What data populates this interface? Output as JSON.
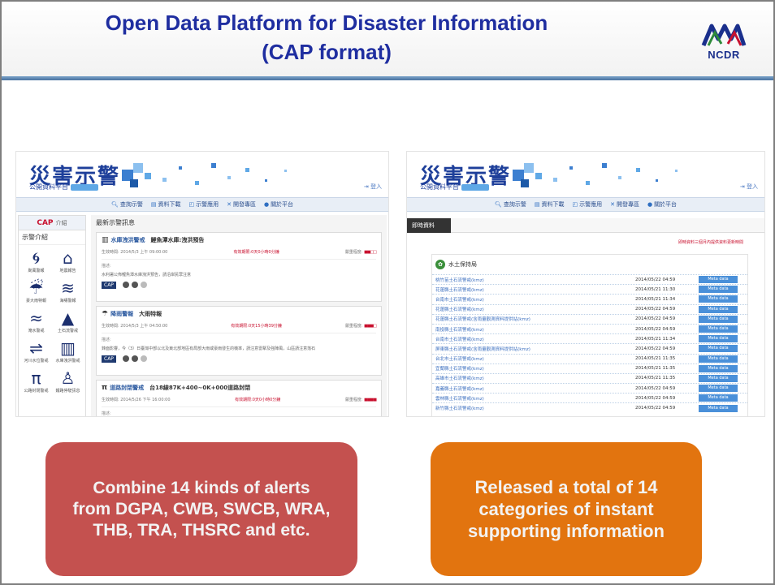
{
  "slide": {
    "title": "Open Data Platform for Disaster Information\n(CAP format)",
    "logo_text": "NCDR",
    "colors": {
      "title": "#1f2ea0",
      "red_bubble": "#c4514f",
      "orange_bubble": "#e2740f",
      "rule": "#4a72a0"
    }
  },
  "left_screenshot": {
    "brand": "災害示警",
    "brand_sub": "公開資料平台",
    "login": "登入",
    "nav": [
      {
        "icon": "search-icon",
        "label": "查詢示警"
      },
      {
        "icon": "download-icon",
        "label": "資料下載"
      },
      {
        "icon": "apps-icon",
        "label": "示警應用"
      },
      {
        "icon": "tools-icon",
        "label": "開發專區"
      },
      {
        "icon": "info-icon",
        "label": "關於平台"
      }
    ],
    "sidebar": {
      "cap_label": "CAP",
      "cap_suffix": "介紹",
      "section_title": "示警介紹",
      "icons": [
        {
          "icon": "typhoon-icon",
          "label": "颱風警報"
        },
        {
          "icon": "house-icon",
          "label": "地震報告"
        },
        {
          "icon": "rain-icon",
          "label": "豪大雨特報"
        },
        {
          "icon": "wave-icon",
          "label": "海嘯警報"
        },
        {
          "icon": "flood-icon",
          "label": "淹水警戒"
        },
        {
          "icon": "landslide-icon",
          "label": "土石流警戒"
        },
        {
          "icon": "river-icon",
          "label": "河川水位警戒"
        },
        {
          "icon": "reservoir-icon",
          "label": "水庫洩洪警戒"
        },
        {
          "icon": "road-icon",
          "label": "公路封閉警戒"
        },
        {
          "icon": "rail-icon",
          "label": "鐵路停駛訊息"
        }
      ]
    },
    "feed": {
      "title": "最新示警訊息",
      "cards": [
        {
          "category": "水庫洩洪警戒",
          "headline": "鯉魚潭水庫:洩洪預告",
          "effective": "生效時間: 2014/5/3 上午 09:00:00",
          "remaining": "有效期限:0天0小時0分鐘",
          "severity_label": "嚴重程度:",
          "severity": "■■□□",
          "desc_label": "描述:",
          "desc": "水利署公佈鯉魚潭水庫洩洪預告，請沿岸民眾注意"
        },
        {
          "category": "降雨警報",
          "headline": "大雨特報",
          "effective": "生效時間: 2014/5/3 上午 04:50:00",
          "remaining": "有效期限:0天15小時39分鐘",
          "severity_label": "嚴重程度:",
          "severity": "■■■□",
          "desc_label": "描述:",
          "desc": "鋒面影響，今（3）日臺灣中部以北及東北部地區有局部大雨或豪雨發生的機率，請注意雷擊及強陣風，山區請注意落石"
        },
        {
          "category": "道路封閉警戒",
          "headline": "台18線87K+400~0K+000道路封閉",
          "effective": "生效時間: 2014/5/26 下午 16:00:00",
          "remaining": "有效期限:0天0小時0分鐘",
          "severity_label": "嚴重程度:",
          "severity": "■■■■",
          "desc_label": "描述:",
          "desc": ""
        }
      ],
      "cap_badge": "CAP"
    }
  },
  "right_screenshot": {
    "brand": "災害示警",
    "brand_sub": "公開資料平台",
    "login": "登入",
    "nav": [
      {
        "icon": "search-icon",
        "label": "查詢示警"
      },
      {
        "icon": "download-icon",
        "label": "資料下載"
      },
      {
        "icon": "apps-icon",
        "label": "示警應用"
      },
      {
        "icon": "tools-icon",
        "label": "開發專區"
      },
      {
        "icon": "info-icon",
        "label": "關於平台"
      }
    ],
    "tab": "即時資料",
    "note": "即時資料三個月內提供資料更新時間",
    "section": "水土保持局",
    "meta_label": "Meta data",
    "rows": [
      {
        "name": "桃竹苗土石流警戒(kmz)",
        "date": "2014/05/22 04:59"
      },
      {
        "name": "花蓮縣土石流警戒(kmz)",
        "date": "2014/05/21 11:30"
      },
      {
        "name": "台南市土石流警戒(kmz)",
        "date": "2014/05/21 11:34"
      },
      {
        "name": "花蓮縣土石流警戒(kmz)",
        "date": "2014/05/22 04:59"
      },
      {
        "name": "花蓮縣土石流警戒(含雨量觀測資料提供站(kmz)",
        "date": "2014/05/22 04:59"
      },
      {
        "name": "南投縣土石流警戒(kmz)",
        "date": "2014/05/22 04:59"
      },
      {
        "name": "台南市土石流警戒(kmz)",
        "date": "2014/05/21 11:34"
      },
      {
        "name": "屏東縣土石流警戒(含雨量觀測資料提供站(kmz)",
        "date": "2014/05/22 04:59"
      },
      {
        "name": "台北市土石流警戒(kmz)",
        "date": "2014/05/21 11:35"
      },
      {
        "name": "宜蘭縣土石流警戒(kmz)",
        "date": "2014/05/21 11:35"
      },
      {
        "name": "高雄市土石流警戒(kmz)",
        "date": "2014/05/21 11:35"
      },
      {
        "name": "嘉義縣土石流警戒(kmz)",
        "date": "2014/05/22 04:59"
      },
      {
        "name": "雲林縣土石流警戒(kmz)",
        "date": "2014/05/22 04:59"
      },
      {
        "name": "新竹縣土石流警戒(kmz)",
        "date": "2014/05/22 04:59"
      }
    ]
  },
  "bubbles": {
    "left": "Combine 14 kinds of alerts\nfrom DGPA, CWB, SWCB, WRA,\nTHB, TRA, THSRC and etc.",
    "right": "Released a total of 14\ncategories  of instant\nsupporting information"
  }
}
